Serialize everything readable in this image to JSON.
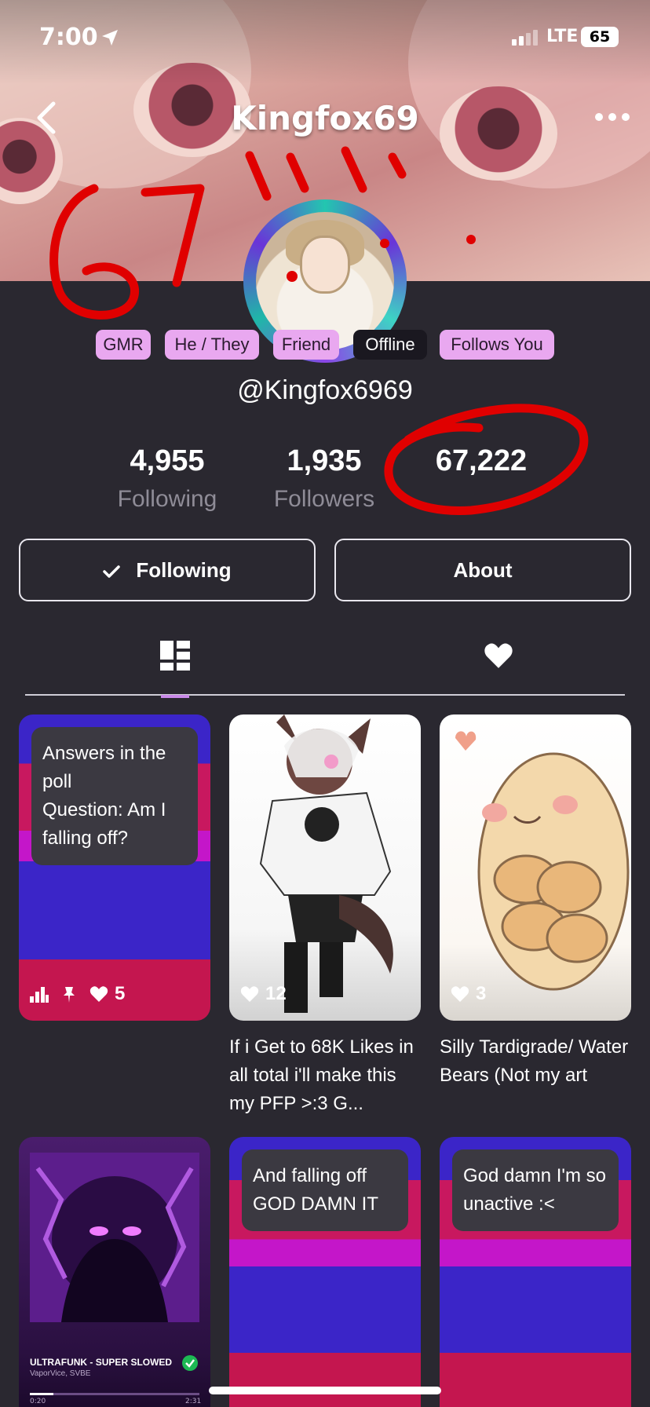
{
  "status_bar": {
    "time": "7:00",
    "network": "LTE",
    "battery": "65"
  },
  "header": {
    "title": "Kingfox69"
  },
  "overlay": {
    "scribble_text": "67!!!"
  },
  "badges": [
    "GMR",
    "He / They",
    "Friend",
    "Offline",
    "Follows You"
  ],
  "profile": {
    "handle": "@Kingfox6969"
  },
  "stats": [
    {
      "value": "4,955",
      "label": "Following"
    },
    {
      "value": "1,935",
      "label": "Followers"
    },
    {
      "value": "67,222",
      "label": ""
    }
  ],
  "buttons": {
    "following": "Following",
    "about": "About"
  },
  "tabs": {
    "active": "posts",
    "items": [
      "posts-grid",
      "likes"
    ]
  },
  "posts": [
    {
      "type": "text",
      "text": "Answers in the poll\nQuestion: Am I falling off?",
      "likes": "5"
    },
    {
      "type": "image",
      "likes": "12",
      "caption": "If i Get to 68K Likes in all total i'll make this my PFP >:3 G..."
    },
    {
      "type": "image",
      "likes": "3",
      "caption": "Silly Tardigrade/ Water Bears (Not my art"
    },
    {
      "type": "music",
      "track": "ULTRAFUNK - SUPER SLOWED",
      "artist": "VaporVice, SVBE",
      "time_start": "0:20",
      "time_end": "2:31"
    },
    {
      "type": "text",
      "text": "And falling off GOD DAMN IT"
    },
    {
      "type": "text",
      "text": "God damn I'm so unactive :<"
    }
  ],
  "colors": {
    "background": "#2a2830",
    "badge": "#e9a8f0",
    "accent": "#c98ae8",
    "scribble": "#e00000"
  }
}
